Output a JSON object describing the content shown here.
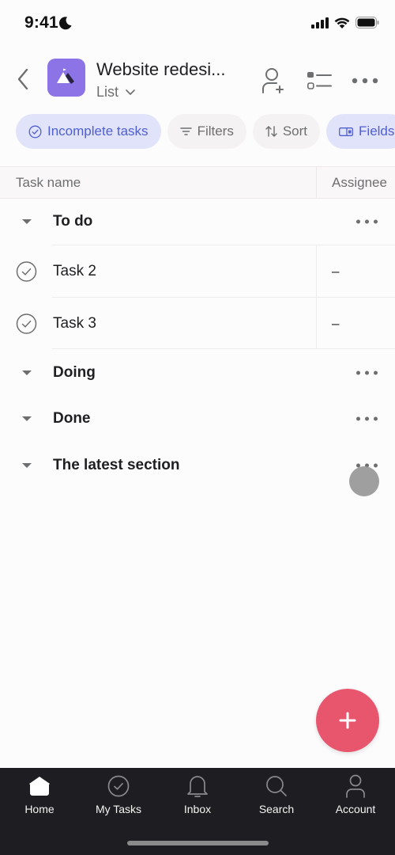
{
  "status_bar": {
    "time": "9:41",
    "focus_icon": "moon-icon",
    "indicators": [
      "cellular-signal-icon",
      "wifi-icon",
      "battery-icon"
    ]
  },
  "header": {
    "back_icon": "chevron-left-icon",
    "project_icon": "mountain-flag-icon",
    "project_color": "#8c73e6",
    "project_title": "Website redesi...",
    "view_label": "List",
    "actions": [
      {
        "name": "add-member",
        "icon": "person-plus-icon"
      },
      {
        "name": "view-options",
        "icon": "list-toggle-icon"
      },
      {
        "name": "more",
        "icon": "more-horizontal-icon"
      }
    ]
  },
  "chips": [
    {
      "label": "Incomplete tasks",
      "icon": "check-circle-icon",
      "active": true
    },
    {
      "label": "Filters",
      "icon": "filter-icon",
      "active": false
    },
    {
      "label": "Sort",
      "icon": "sort-icon",
      "active": false
    },
    {
      "label": "Fields",
      "icon": "fields-icon",
      "active": true
    }
  ],
  "table": {
    "columns": [
      "Task name",
      "Assignee"
    ],
    "sections": [
      {
        "name": "To do",
        "tasks": [
          {
            "name": "Task 2",
            "assignee": "–"
          },
          {
            "name": "Task 3",
            "assignee": "–"
          }
        ]
      },
      {
        "name": "Doing",
        "tasks": []
      },
      {
        "name": "Done",
        "tasks": []
      },
      {
        "name": "The latest section",
        "tasks": []
      }
    ]
  },
  "fab": {
    "icon": "plus-icon",
    "color": "#e8566e"
  },
  "bottom_nav": {
    "items": [
      {
        "label": "Home",
        "icon": "home-icon",
        "active": true
      },
      {
        "label": "My Tasks",
        "icon": "check-circle-icon",
        "active": false
      },
      {
        "label": "Inbox",
        "icon": "bell-icon",
        "active": false
      },
      {
        "label": "Search",
        "icon": "search-icon",
        "active": false
      },
      {
        "label": "Account",
        "icon": "person-icon",
        "active": false
      }
    ]
  }
}
